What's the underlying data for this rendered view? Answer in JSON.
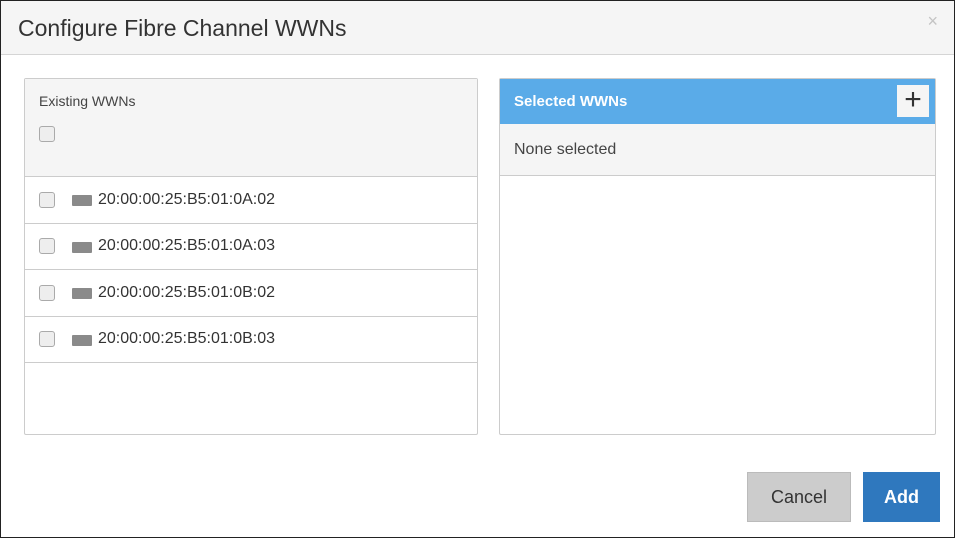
{
  "dialog": {
    "title": "Configure Fibre Channel WWNs",
    "close": "×"
  },
  "existing": {
    "label": "Existing WWNs",
    "items": [
      "20:00:00:25:B5:01:0A:02",
      "20:00:00:25:B5:01:0A:03",
      "20:00:00:25:B5:01:0B:02",
      "20:00:00:25:B5:01:0B:03"
    ]
  },
  "selected": {
    "label": "Selected WWNs",
    "add": "+",
    "empty": "None selected"
  },
  "buttons": {
    "cancel": "Cancel",
    "add": "Add"
  }
}
